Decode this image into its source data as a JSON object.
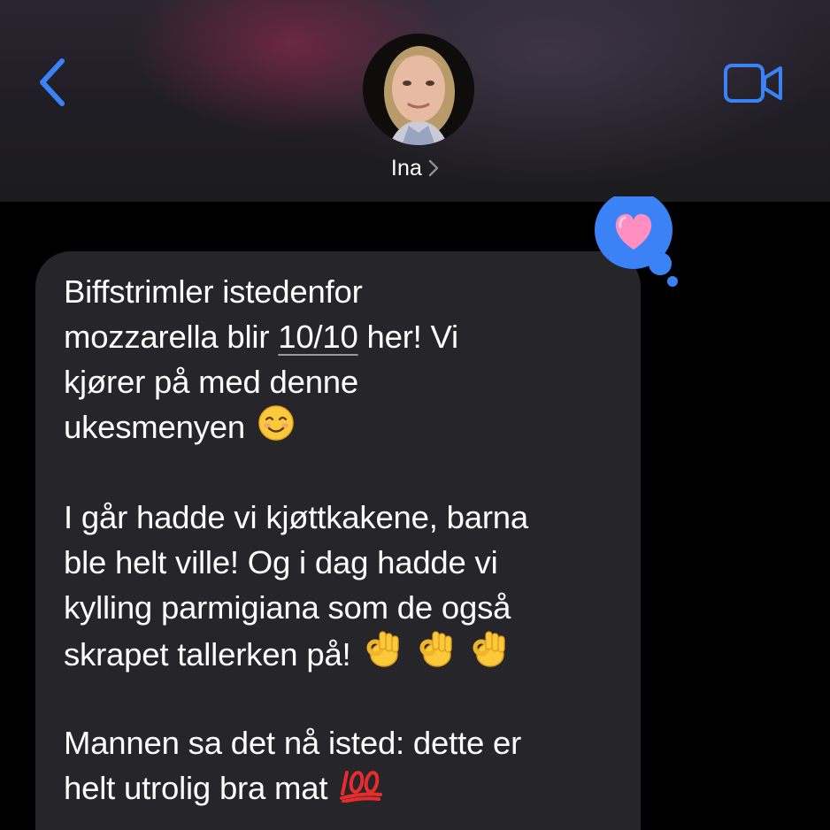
{
  "header": {
    "contact_name": "Ina",
    "back_icon": "chevron-left-icon",
    "video_icon": "video-camera-icon",
    "accent_color": "#3b82f6"
  },
  "message": {
    "line1": "Biffstrimler istedenfor",
    "line2_pre": "mozzarella blir ",
    "line2_link": "10/10",
    "line2_post": " her! Vi",
    "line3": "kjører på med denne",
    "line4": "ukesmenyen",
    "line5": "I går hadde vi kjøttkakene, barna",
    "line6": "ble helt ville! Og i dag hadde vi",
    "line7": "kylling parmigiana som de også",
    "line8": "skrapet tallerken på!",
    "line9": "Mannen sa det nå isted: dette er",
    "line10": "helt utrolig bra mat",
    "emojis": {
      "smile": "smiling-face-icon",
      "ok_hand": "ok-hand-icon",
      "hundred": "hundred-points-icon"
    }
  },
  "tapback": {
    "reaction": "heart-icon",
    "bubble_color": "#3b82f6",
    "heart_color": "#ff8fc0"
  }
}
